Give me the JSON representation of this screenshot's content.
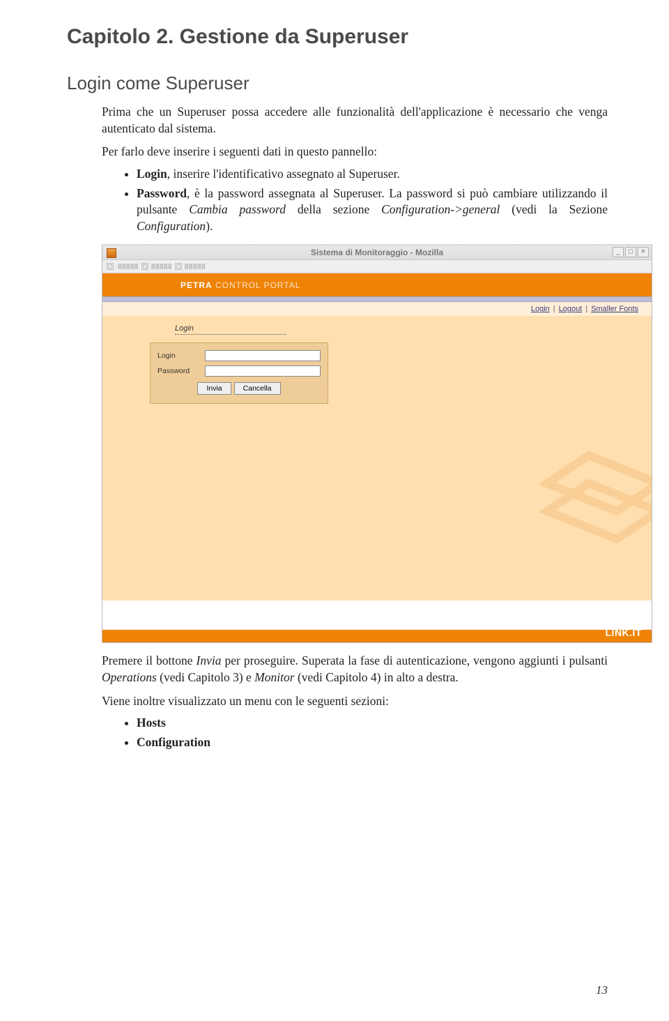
{
  "chapter_title": "Capitolo 2. Gestione da Superuser",
  "section_title": "Login come Superuser",
  "intro_text": "Prima che un Superuser possa accedere alle funzionalità dell'applicazione è necessario che venga autenticato dal sistema.",
  "intro_text2": "Per farlo deve inserire i seguenti dati in questo pannello:",
  "bullet1_bold": "Login",
  "bullet1_rest": ", inserire l'identificativo assegnato al Superuser.",
  "bullet2_bold": "Password",
  "bullet2_rest_a": ", è la password assegnata al Superuser. La password si può cambiare utilizzando il pulsante ",
  "bullet2_em1": "Cambia password",
  "bullet2_rest_b": " della sezione ",
  "bullet2_em2": "Configuration->general",
  "bullet2_rest_c": " (vedi la Sezione ",
  "bullet2_em3": "Configuration",
  "bullet2_rest_d": ").",
  "after_text_a": "Premere il bottone ",
  "after_em1": "Invia",
  "after_text_b": " per proseguire. Superata la fase di autenticazione, vengono aggiunti i pulsanti ",
  "after_em2": "Operations",
  "after_text_c": " (vedi Capitolo 3) e ",
  "after_em3": "Monitor",
  "after_text_d": " (vedi Capitolo 4) in alto a destra.",
  "after_text2": "Viene inoltre visualizzato un menu con le seguenti sezioni:",
  "end_bullet1": "Hosts",
  "end_bullet2": "Configuration",
  "page_number": "13",
  "window": {
    "title": "Sistema di Monitoraggio - Mozilla",
    "brand_bold": "PETRA",
    "brand_light": " CONTROL PORTAL",
    "nav": {
      "login": "Login",
      "logout": "Logout",
      "smaller": "Smaller Fonts"
    },
    "login_header": "Login",
    "field_login": "Login",
    "field_password": "Password",
    "btn_submit": "Invia",
    "btn_cancel": "Cancella",
    "footer_brand": "LINK.IT"
  }
}
